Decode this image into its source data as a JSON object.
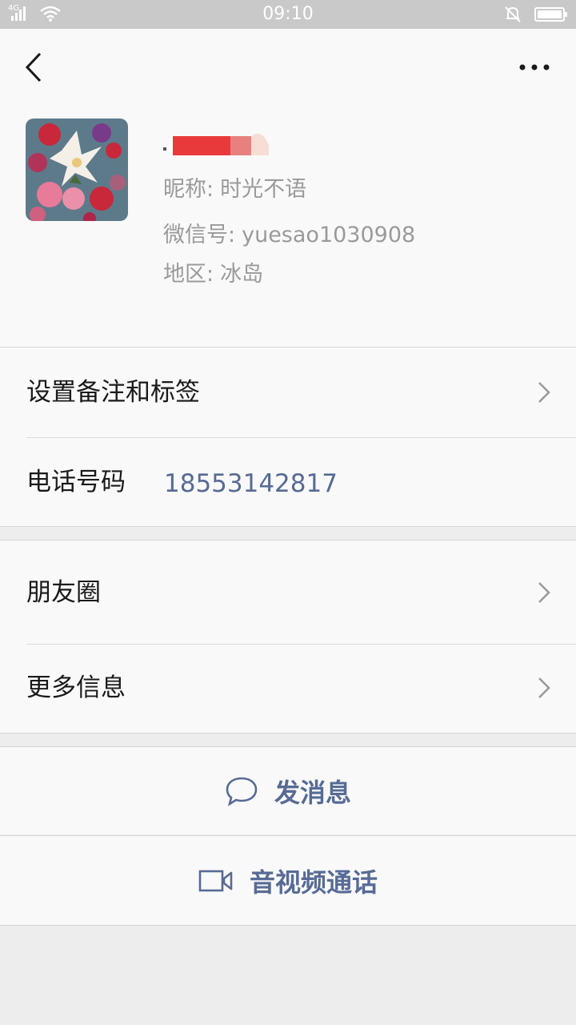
{
  "status_bar": {
    "network": "4G",
    "time": "09:10"
  },
  "profile": {
    "nickname_label": "昵称:",
    "nickname": "时光不语",
    "wechat_id_label": "微信号:",
    "wechat_id": "yuesao1030908",
    "region_label": "地区:",
    "region": "冰岛"
  },
  "rows": {
    "remark_tags": "设置备注和标签",
    "phone_label": "电话号码",
    "phone_value": "18553142817",
    "moments": "朋友圈",
    "more_info": "更多信息"
  },
  "actions": {
    "send_message": "发消息",
    "video_call": "音视频通话"
  },
  "colors": {
    "link_blue": "#576b95",
    "redaction_red": "#e83a3a",
    "page_bg": "#ededed",
    "card_bg": "#f9f9f9"
  },
  "icons": {
    "back": "back-arrow-icon",
    "more": "more-dots-icon",
    "chevron": "chevron-right-icon",
    "message": "chat-bubble-icon",
    "video": "video-camera-icon"
  }
}
